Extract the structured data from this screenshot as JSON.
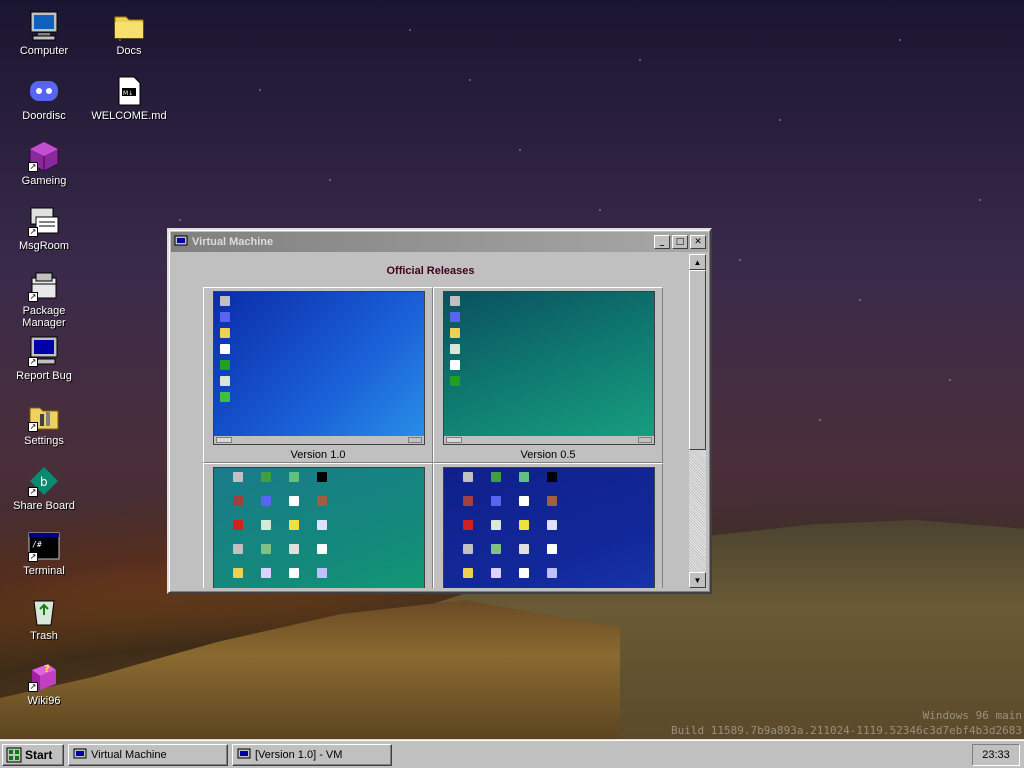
{
  "desktop": {
    "icons": [
      {
        "label": "Computer",
        "icon": "computer-icon"
      },
      {
        "label": "Docs",
        "icon": "folder-icon"
      },
      {
        "label": "Doordisc",
        "icon": "doordisc-icon"
      },
      {
        "label": "WELCOME.md",
        "icon": "markdown-file-icon"
      },
      {
        "label": "Gameing",
        "icon": "game-cube-icon"
      },
      {
        "label": "MsgRoom",
        "icon": "msgroom-icon"
      },
      {
        "label": "Package Manager",
        "icon": "package-icon"
      },
      {
        "label": "Report Bug",
        "icon": "monitor-icon"
      },
      {
        "label": "Settings",
        "icon": "settings-folder-icon"
      },
      {
        "label": "Share Board",
        "icon": "share-board-icon"
      },
      {
        "label": "Terminal",
        "icon": "terminal-icon"
      },
      {
        "label": "Trash",
        "icon": "recycle-bin-icon"
      },
      {
        "label": "Wiki96",
        "icon": "help-book-icon"
      }
    ],
    "watermark": {
      "line1": "Windows 96 main",
      "line2": "Build 11589.7b9a893a.211024-1119.52346c3d7ebf4b3d2683"
    }
  },
  "window": {
    "title": "Virtual Machine",
    "minimize": "_",
    "maximize": "□",
    "close": "✕",
    "heading": "Official Releases",
    "releases": [
      {
        "label": "Version 1.0"
      },
      {
        "label": "Version 0.5"
      },
      {
        "label": ""
      },
      {
        "label": ""
      }
    ],
    "scroll_up": "▲",
    "scroll_down": "▼"
  },
  "taskbar": {
    "start_label": "Start",
    "tasks": [
      {
        "label": "Virtual Machine"
      },
      {
        "label": "[Version 1.0] - VM"
      }
    ],
    "clock": "23:33"
  },
  "colors": {
    "v10_bg": "#1a4cc8",
    "v05_bg": "#0f7a70",
    "v3_bg": "#138a7a",
    "v4_bg": "#12289a",
    "heading": "#400020"
  }
}
